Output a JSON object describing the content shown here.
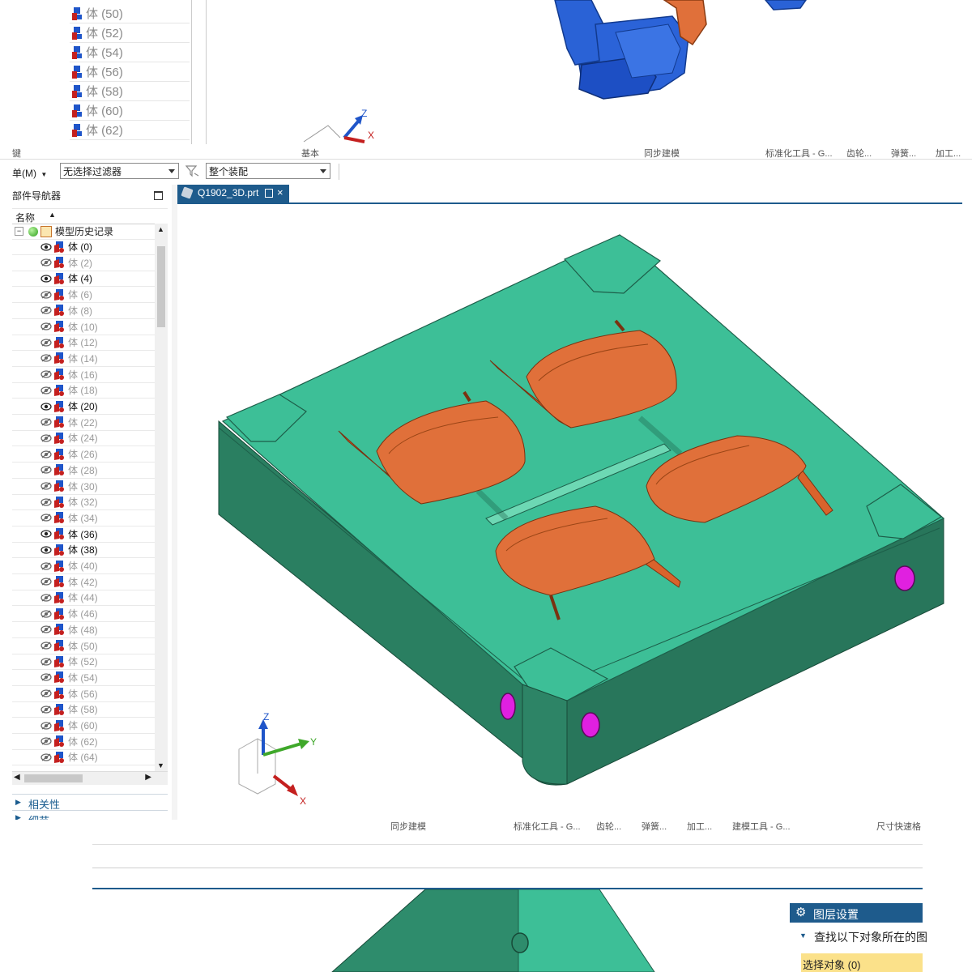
{
  "top_tree": {
    "items": [
      "体 (50)",
      "体 (52)",
      "体 (54)",
      "体 (56)",
      "体 (58)",
      "体 (60)",
      "体 (62)"
    ]
  },
  "top_axes": {
    "z": "Z",
    "x": "X"
  },
  "ribbon": {
    "tabs": [
      "键",
      "基本",
      "同步建模",
      "标准化工具 - G...",
      "齿轮...",
      "弹簧...",
      "加工..."
    ]
  },
  "filter_bar": {
    "menu_label": "单(M)",
    "filter_value": "无选择过滤器",
    "assembly_value": "整个装配"
  },
  "navigator": {
    "title": "部件导航器",
    "column_name": "名称",
    "root": "模型历史记录",
    "items": [
      {
        "label": "体 (0)",
        "visible": true
      },
      {
        "label": "体 (2)",
        "visible": false
      },
      {
        "label": "体 (4)",
        "visible": true
      },
      {
        "label": "体 (6)",
        "visible": false
      },
      {
        "label": "体 (8)",
        "visible": false
      },
      {
        "label": "体 (10)",
        "visible": false
      },
      {
        "label": "体 (12)",
        "visible": false
      },
      {
        "label": "体 (14)",
        "visible": false
      },
      {
        "label": "体 (16)",
        "visible": false
      },
      {
        "label": "体 (18)",
        "visible": false
      },
      {
        "label": "体 (20)",
        "visible": true
      },
      {
        "label": "体 (22)",
        "visible": false
      },
      {
        "label": "体 (24)",
        "visible": false
      },
      {
        "label": "体 (26)",
        "visible": false
      },
      {
        "label": "体 (28)",
        "visible": false
      },
      {
        "label": "体 (30)",
        "visible": false
      },
      {
        "label": "体 (32)",
        "visible": false
      },
      {
        "label": "体 (34)",
        "visible": false
      },
      {
        "label": "体 (36)",
        "visible": true
      },
      {
        "label": "体 (38)",
        "visible": true
      },
      {
        "label": "体 (40)",
        "visible": false
      },
      {
        "label": "体 (42)",
        "visible": false
      },
      {
        "label": "体 (44)",
        "visible": false
      },
      {
        "label": "体 (46)",
        "visible": false
      },
      {
        "label": "体 (48)",
        "visible": false
      },
      {
        "label": "体 (50)",
        "visible": false
      },
      {
        "label": "体 (52)",
        "visible": false
      },
      {
        "label": "体 (54)",
        "visible": false
      },
      {
        "label": "体 (56)",
        "visible": false
      },
      {
        "label": "体 (58)",
        "visible": false
      },
      {
        "label": "体 (60)",
        "visible": false
      },
      {
        "label": "体 (62)",
        "visible": false
      },
      {
        "label": "体 (64)",
        "visible": false
      }
    ],
    "section_dependency": "相关性",
    "section_details": "细节"
  },
  "viewport": {
    "tab_label": "Q1902_3D.prt",
    "axes": {
      "x": "X",
      "y": "Y",
      "z": "Z"
    }
  },
  "bottom_ribbon": {
    "tabs": [
      "同步建模",
      "标准化工具 - G...",
      "齿轮...",
      "弹簧...",
      "加工...",
      "建模工具 - G...",
      "尺寸快速格"
    ]
  },
  "layer_panel": {
    "title": "图层设置",
    "subtitle": "查找以下对象所在的图",
    "select_label": "选择对象 (0)"
  },
  "colors": {
    "mold_green": "#3dbf97",
    "mold_dark": "#2e8c6c",
    "part_orange": "#e0703a",
    "blue_part": "#1f55c9",
    "hole_magenta": "#e020e0",
    "accent_blue": "#1e5b8c"
  }
}
